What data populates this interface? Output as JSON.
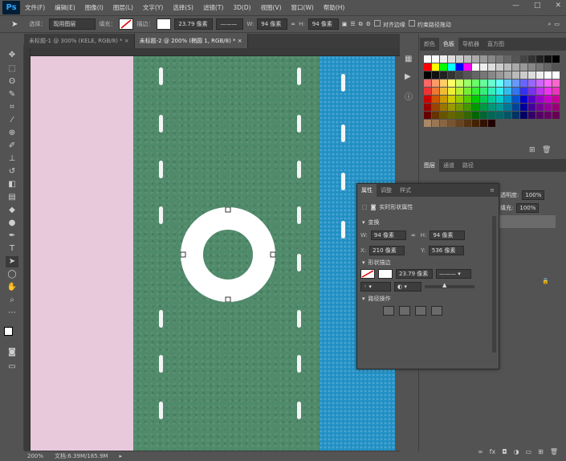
{
  "menubar": {
    "logo": "Ps",
    "items": [
      "文件(F)",
      "编辑(E)",
      "图像(I)",
      "图层(L)",
      "文字(Y)",
      "选择(S)",
      "滤镜(T)",
      "3D(D)",
      "视图(V)",
      "窗口(W)",
      "帮助(H)"
    ]
  },
  "options": {
    "select_label": "选择：",
    "select_value": "现用图层",
    "fill_label": "填充：",
    "stroke_label": "描边：",
    "stroke_size": "23.79 像素",
    "w_label": "W:",
    "w_value": "94 像素",
    "h_label": "H:",
    "h_value": "94 像素",
    "align_edges": "对齐边缘",
    "constrain_path": "约束路径拖动"
  },
  "tabs": [
    {
      "label": "未标题-1 @ 300% (KELE, RGB/8) *",
      "close": "×"
    },
    {
      "label": "未标题-2 @ 200% (椭圆 1, RGB/8) *",
      "close": "×"
    }
  ],
  "status": {
    "zoom": "200%",
    "doc": "文档:6.39M/185.9M"
  },
  "swatch_panel": {
    "tabs": [
      "颜色",
      "色板",
      "导航器",
      "直方图"
    ],
    "active": "色板"
  },
  "layers_panel": {
    "tabs": [
      "图层",
      "通道",
      "路径"
    ],
    "opacity_label": "透明度:",
    "opacity_value": "100%",
    "fill_label": "填充:",
    "fill_value": "100%"
  },
  "properties": {
    "tabs": [
      "属性",
      "调整",
      "样式"
    ],
    "title": "实时形状属性",
    "section_transform": "变换",
    "w_label": "W:",
    "w_value": "94 像素",
    "h_label": "H:",
    "h_value": "94 像素",
    "x_label": "X:",
    "x_value": "210 像素",
    "y_label": "Y:",
    "y_value": "536 像素",
    "section_shape": "形状描边",
    "stroke_size": "23.79 像素",
    "section_path": "路径操作"
  },
  "colors": {
    "pink": "#e8c9dc",
    "green": "#4f8a6a",
    "blue": "#1f8fc4",
    "panel": "#535353",
    "dark": "#3c3c3c"
  }
}
